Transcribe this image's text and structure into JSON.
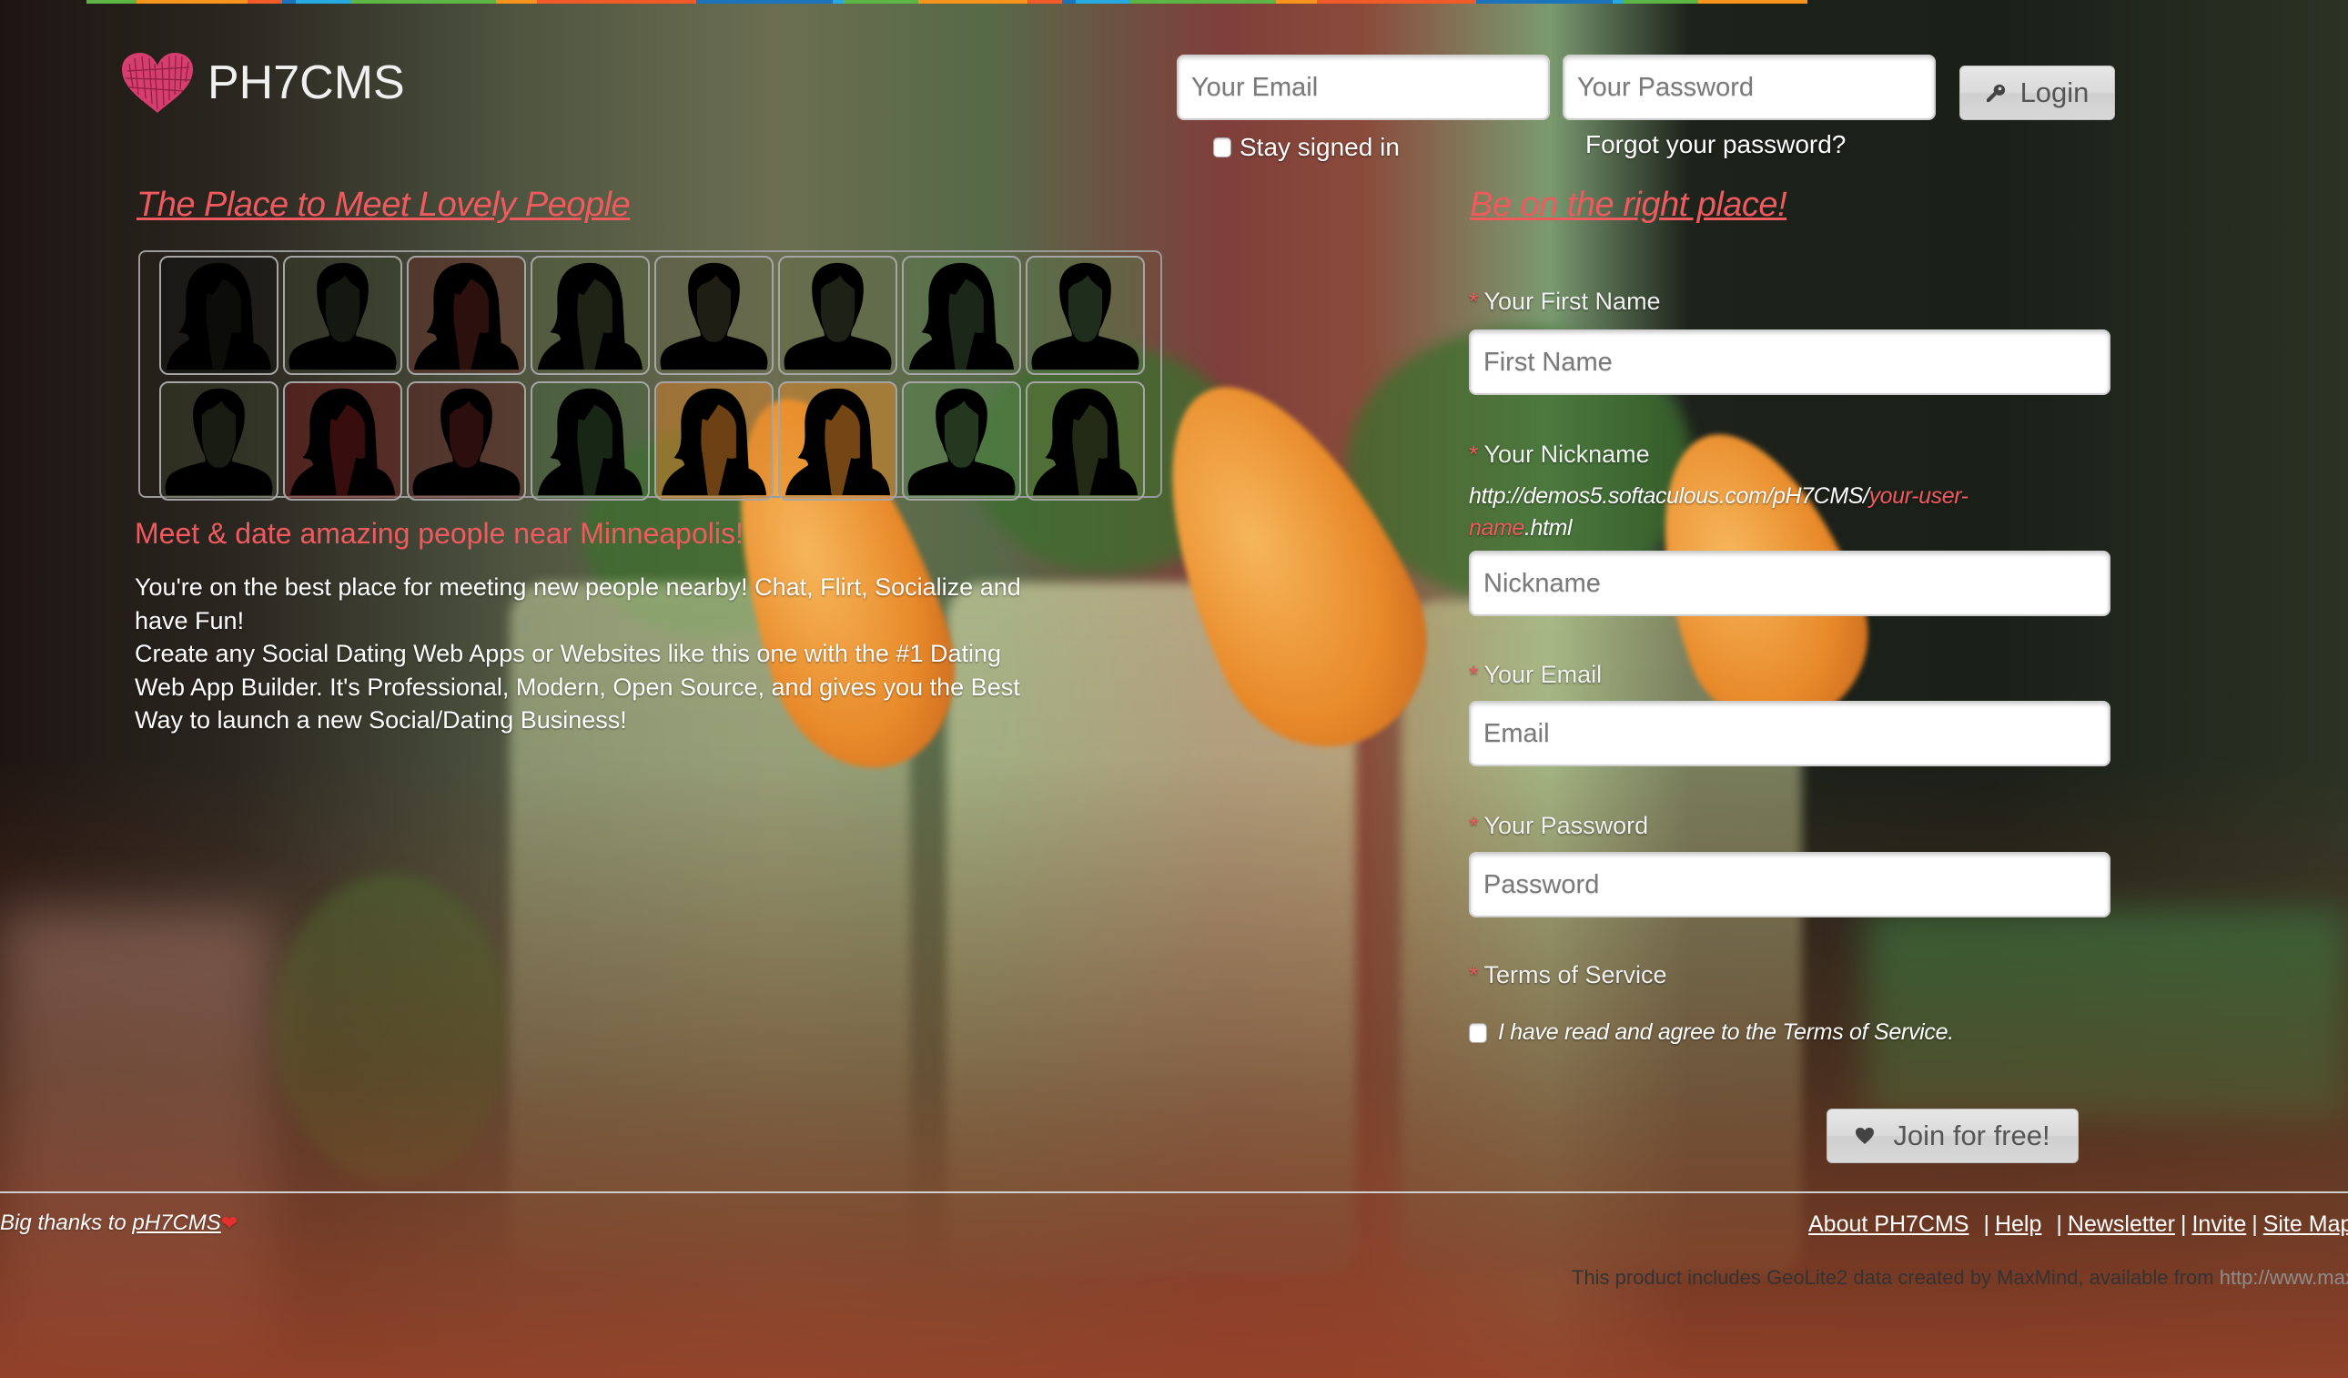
{
  "brand": {
    "name": "PH7CMS",
    "logo_icon": "scribble-heart-icon",
    "accent_color": "#ef5a5f"
  },
  "top_bar_colors": [
    "#5cb545",
    "#f7941d",
    "#f15a29",
    "#1c75bc",
    "#27aae1",
    "#5cb545",
    "#f7941d",
    "#f15a29",
    "#1c75bc",
    "#27aae1",
    "#5cb545",
    "#f7941d",
    "#f15a29",
    "#1c75bc",
    "#27aae1",
    "#5cb545",
    "#f7941d",
    "#f15a29",
    "#1c75bc",
    "#27aae1",
    "#5cb545",
    "#f7941d"
  ],
  "login": {
    "email_placeholder": "Your Email",
    "password_placeholder": "Your Password",
    "button_label": "Login",
    "button_icon": "key-icon",
    "stay_signed_in": "Stay signed in",
    "stay_signed_in_checked": false,
    "forgot_password": "Forgot your password?"
  },
  "left": {
    "heading": "The Place to Meet Lovely People",
    "avatars": [
      {
        "gender": "female"
      },
      {
        "gender": "male"
      },
      {
        "gender": "female"
      },
      {
        "gender": "female"
      },
      {
        "gender": "male"
      },
      {
        "gender": "male"
      },
      {
        "gender": "female"
      },
      {
        "gender": "male"
      },
      {
        "gender": "male"
      },
      {
        "gender": "female"
      },
      {
        "gender": "male"
      },
      {
        "gender": "female"
      },
      {
        "gender": "female"
      },
      {
        "gender": "female"
      },
      {
        "gender": "male"
      },
      {
        "gender": "female"
      }
    ],
    "tagline": "Meet & date amazing people near Minneapolis!",
    "paragraphs": [
      "You're on the best place for meeting new people nearby! Chat, Flirt, Socialize and have Fun!",
      "Create any Social Dating Web Apps or Websites like this one with the #1 Dating Web App Builder. It's Professional, Modern, Open Source, and gives you the Best Way to launch a new Social/Dating Business!"
    ]
  },
  "signup": {
    "heading": "Be on the right place!",
    "required_marker": "*",
    "first_name": {
      "label": "Your First Name",
      "placeholder": "First Name",
      "value": ""
    },
    "nickname": {
      "label": "Your Nickname",
      "url_prefix": "http://demos5.softaculous.com/pH7CMS/",
      "url_placeholder": "your-user-name",
      "url_suffix": ".html",
      "placeholder": "Nickname",
      "value": ""
    },
    "email": {
      "label": "Your Email",
      "placeholder": "Email",
      "value": ""
    },
    "password": {
      "label": "Your Password",
      "placeholder": "Password",
      "value": ""
    },
    "terms": {
      "label": "Terms of Service",
      "agree_text": "I have read and agree to the Terms of Service.",
      "checked": false
    },
    "submit_label": "Join for free!",
    "submit_icon": "heart-icon"
  },
  "footer": {
    "thanks_prefix": "Big thanks to ",
    "thanks_link": "pH7CMS",
    "thanks_emoji": "❤",
    "links": [
      "About PH7CMS",
      "Help",
      "Newsletter",
      "Invite",
      "Site Map"
    ],
    "maxmind_text": "This product includes GeoLite2 data created by MaxMind, available from ",
    "maxmind_link": "http://www.maxmind.com"
  }
}
